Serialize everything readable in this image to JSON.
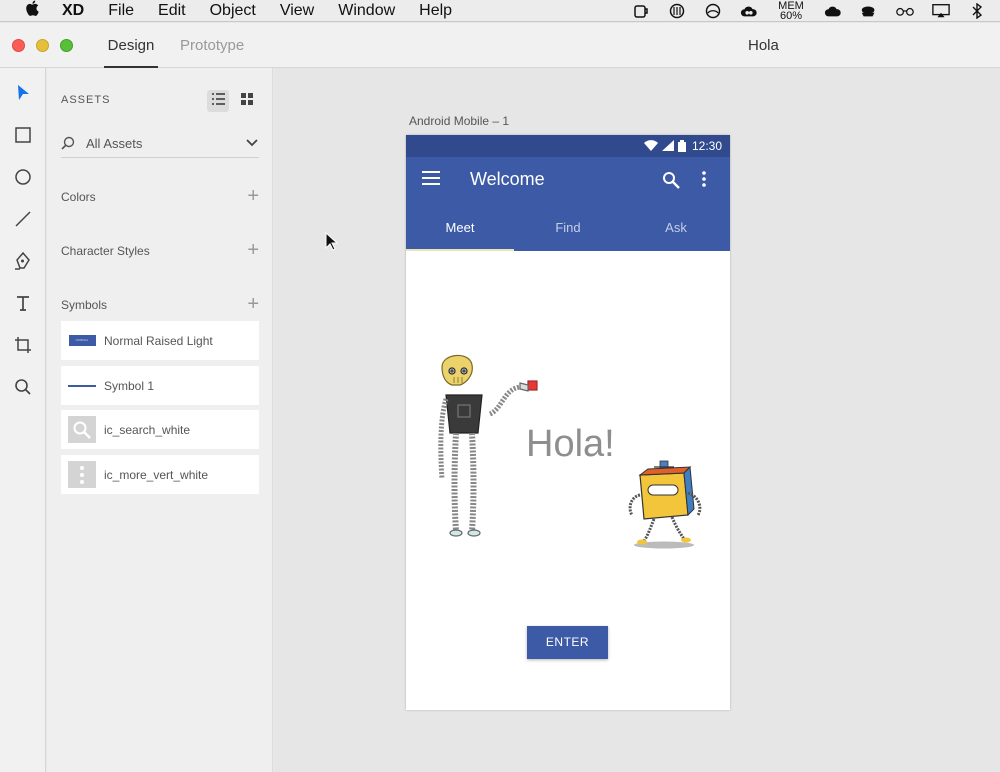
{
  "menubar": {
    "app": "XD",
    "items": [
      "File",
      "Edit",
      "Object",
      "View",
      "Window",
      "Help"
    ],
    "mem_label": "MEM",
    "mem_value": "60%"
  },
  "titlebar": {
    "tab_design": "Design",
    "tab_prototype": "Prototype",
    "doc_title": "Hola"
  },
  "assets": {
    "title": "ASSETS",
    "filter_label": "All Assets",
    "sections": {
      "colors": "Colors",
      "character_styles": "Character Styles",
      "symbols": "Symbols"
    },
    "symbols": [
      {
        "name": "Normal Raised Light",
        "icon": "button-thumb"
      },
      {
        "name": "Symbol 1",
        "icon": "line-thumb"
      },
      {
        "name": "ic_search_white",
        "icon": "search-icon"
      },
      {
        "name": "ic_more_vert_white",
        "icon": "more-vert-icon"
      }
    ],
    "button_thumb_text": "NORMAL"
  },
  "artboard": {
    "label": "Android Mobile – 1",
    "status_time": "12:30",
    "appbar_title": "Welcome",
    "tabs": [
      "Meet",
      "Find",
      "Ask"
    ],
    "active_tab": "Meet",
    "greeting": "Hola!",
    "enter_label": "ENTER"
  },
  "colors": {
    "primary": "#3c5aa6",
    "primary_dark": "#304a8d",
    "accent_tool": "#1473e6"
  }
}
